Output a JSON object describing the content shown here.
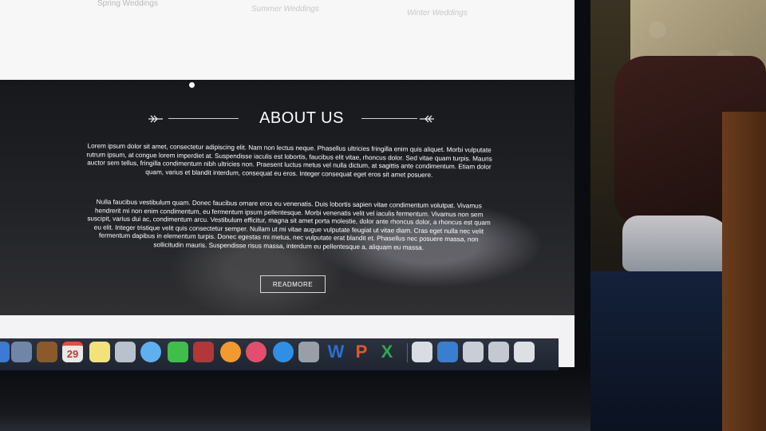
{
  "website": {
    "categories": [
      "Spring Weddings",
      "Summer Weddings",
      "Winter Weddings"
    ],
    "about": {
      "title": "ABOUT US",
      "paragraph1": "Lorem ipsum dolor sit amet, consectetur adipiscing elit. Nam non lectus neque. Phasellus ultricies fringilla enim quis aliquet. Morbi vulputate rutrum ipsum, at congue lorem imperdiet at. Suspendisse iaculis est lobortis, faucibus elit vitae, rhoncus dolor. Sed vitae quam turpis. Mauris auctor sem tellus, fringilla condimentum nibh ultricies non. Praesent luctus metus vel nulla dictum, at sagittis ante condimentum. Etiam dolor quam, varius et blandit interdum, consequat eu eros. Integer consequat eget eros sit amet posuere.",
      "paragraph2": "Nulla faucibus vestibulum quam. Donec faucibus ornare eros eu venenatis. Duis lobortis sapien vitae condimentum volutpat. Vivamus hendrerit mi non enim condimentum, eu fermentum ipsum pellentesque. Morbi venenatis velit vel iaculis fermentum. Vivamus non sem suscipit, varius dui ac, condimentum arcu. Vestibulum efficitur, magna sit amet porta molestie, dolor ante rhoncus dolor, a rhoncus est quam eu elit. Integer tristique velit quis consectetur semper. Nullam ut mi vitae augue vulputate feugiat ut vitae diam. Cras eget nulla nec velit fermentum dapibus in elementum turpis. Donec egestas mi metus, nec vulputate erat blandit et. Phasellus nec posuere massa, non sollicitudin mauris. Suspendisse risus massa, interdum eu pellentesque a, aliquam eu massa.",
      "button": "READMORE"
    }
  },
  "dock": {
    "calendar_date": "29",
    "apps": [
      {
        "name": "finder-icon",
        "glyph": "",
        "color": "#3b7bd6"
      },
      {
        "name": "preview-icon",
        "glyph": "",
        "color": "#6f86a8"
      },
      {
        "name": "contacts-icon",
        "glyph": "",
        "color": "#8a5a2b"
      },
      {
        "name": "calendar-icon",
        "glyph": "29",
        "color": "#e9e9e9"
      },
      {
        "name": "notes-icon",
        "glyph": "",
        "color": "#f2e27a"
      },
      {
        "name": "photo-booth-icon",
        "glyph": "",
        "color": "#b8c2cc"
      },
      {
        "name": "messages-icon",
        "glyph": "",
        "color": "#5fb0f0"
      },
      {
        "name": "facetime-icon",
        "glyph": "",
        "color": "#3fbf4a"
      },
      {
        "name": "photo-collage-icon",
        "glyph": "",
        "color": "#b23838"
      },
      {
        "name": "photos-icon",
        "glyph": "",
        "color": "#f29a2e"
      },
      {
        "name": "itunes-icon",
        "glyph": "",
        "color": "#e34e6c"
      },
      {
        "name": "app-store-icon",
        "glyph": "",
        "color": "#2f8fe6"
      },
      {
        "name": "system-preferences-icon",
        "glyph": "",
        "color": "#9a9ea6"
      },
      {
        "name": "word-icon",
        "glyph": "W",
        "color": "#2b6fd1"
      },
      {
        "name": "powerpoint-icon",
        "glyph": "P",
        "color": "#e0582d"
      },
      {
        "name": "excel-icon",
        "glyph": "X",
        "color": "#2fa84f"
      },
      {
        "name": "documents-icon",
        "glyph": "",
        "color": "#d8dde4"
      },
      {
        "name": "quicktime-icon",
        "glyph": "",
        "color": "#3a7ed0"
      },
      {
        "name": "screen-sharing-icon",
        "glyph": "",
        "color": "#c9ced6"
      },
      {
        "name": "downloads-stack-icon",
        "glyph": "",
        "color": "#c4c9d1"
      },
      {
        "name": "trash-icon",
        "glyph": "",
        "color": "#dcdfe4"
      }
    ]
  }
}
